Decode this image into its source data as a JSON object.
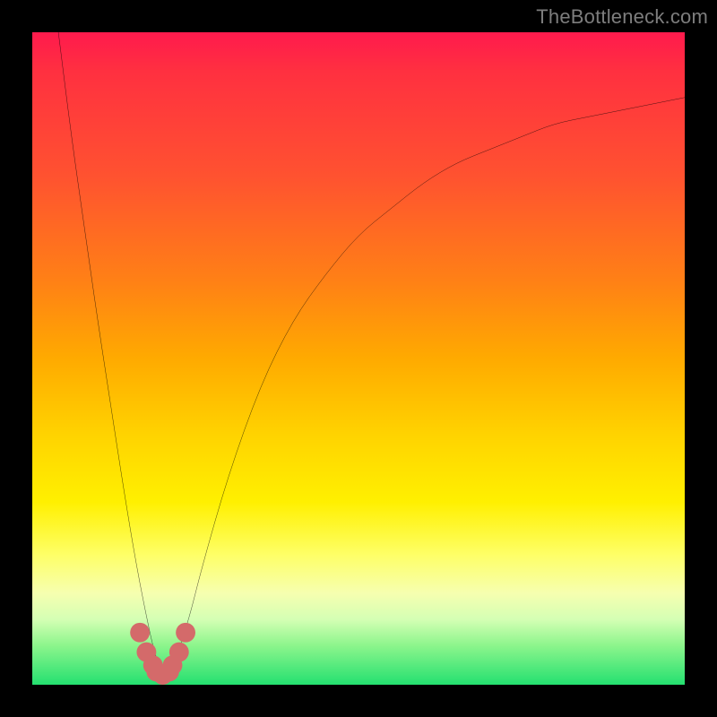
{
  "watermark": "TheBottleneck.com",
  "chart_data": {
    "type": "line",
    "title": "",
    "xlabel": "",
    "ylabel": "",
    "xlim": [
      0,
      100
    ],
    "ylim": [
      0,
      100
    ],
    "series": [
      {
        "name": "bottleneck-curve",
        "x": [
          4,
          6,
          8,
          10,
          12,
          14,
          16,
          18,
          19,
          20,
          21,
          22,
          24,
          26,
          30,
          35,
          40,
          45,
          50,
          55,
          60,
          65,
          70,
          75,
          80,
          85,
          90,
          95,
          100
        ],
        "y": [
          100,
          84,
          70,
          56,
          43,
          30,
          18,
          8,
          4,
          2,
          2,
          4,
          10,
          18,
          32,
          46,
          56,
          63,
          69,
          73,
          77,
          80,
          82,
          84,
          86,
          87,
          88,
          89,
          90
        ]
      }
    ],
    "markers": {
      "name": "highlight-points",
      "color": "#d46a6a",
      "x": [
        16.5,
        17.5,
        18.5,
        19.0,
        20.0,
        21.0,
        21.5,
        22.5,
        23.5
      ],
      "y": [
        8,
        5,
        3,
        2,
        1.5,
        2,
        3,
        5,
        8
      ]
    }
  }
}
